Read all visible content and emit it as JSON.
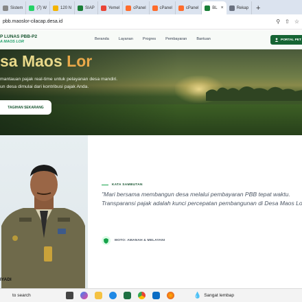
{
  "browser": {
    "tabs": [
      {
        "label": "Sistem",
        "color": "#888888"
      },
      {
        "label": "(7) W",
        "color": "#25d366"
      },
      {
        "label": "120 N",
        "color": "#f4b400"
      },
      {
        "label": "SIAP",
        "color": "#1a7f37"
      },
      {
        "label": "Yemel",
        "color": "#ea4335"
      },
      {
        "label": "cPanel",
        "color": "#ff6c2c"
      },
      {
        "label": "cPanel",
        "color": "#ff6c2c"
      },
      {
        "label": "cPanel",
        "color": "#ff6c2c"
      },
      {
        "label": "BL",
        "color": "#1a7f37",
        "active": true
      },
      {
        "label": "Rekap",
        "color": "#6b7280"
      }
    ],
    "new_tab": "+",
    "url": "pbb.maoslor-cilacap.desa.id"
  },
  "site": {
    "brand_title": "P LUNAS PBB-P2",
    "brand_subtitle": "A MAOS LOR",
    "menu": [
      "Beranda",
      "Layanan",
      "Progres",
      "Pembayaran",
      "Bantuan"
    ],
    "portal_button": "PORTAL PET"
  },
  "hero": {
    "title_part1": "sa Maos ",
    "title_part2": "Lor",
    "line1": "mantauan pajak real-time untuk pelayanan desa mandiri.",
    "line2": "un desa dimulai dari kontribusi pajak Anda.",
    "cta": "TAGIHAN SEKARANG"
  },
  "sambutan": {
    "person_name": "IYADI",
    "kicker": "KATA SAMBUTAN",
    "quote": "\"Mari bersama membangun desa melalui pembayaran PBB tepat waktu. Transparansi pajak adalah kunci percepatan pembangunan di Desa Maos Lor\"",
    "motto": "MOTO: AMANAH & MELAYANI"
  },
  "taskbar": {
    "search": "to search",
    "weather": "Sangat lembap"
  },
  "colors": {
    "brand_green": "#166534",
    "accent_green": "#22a06b",
    "title_gold": "#e9d98a"
  }
}
